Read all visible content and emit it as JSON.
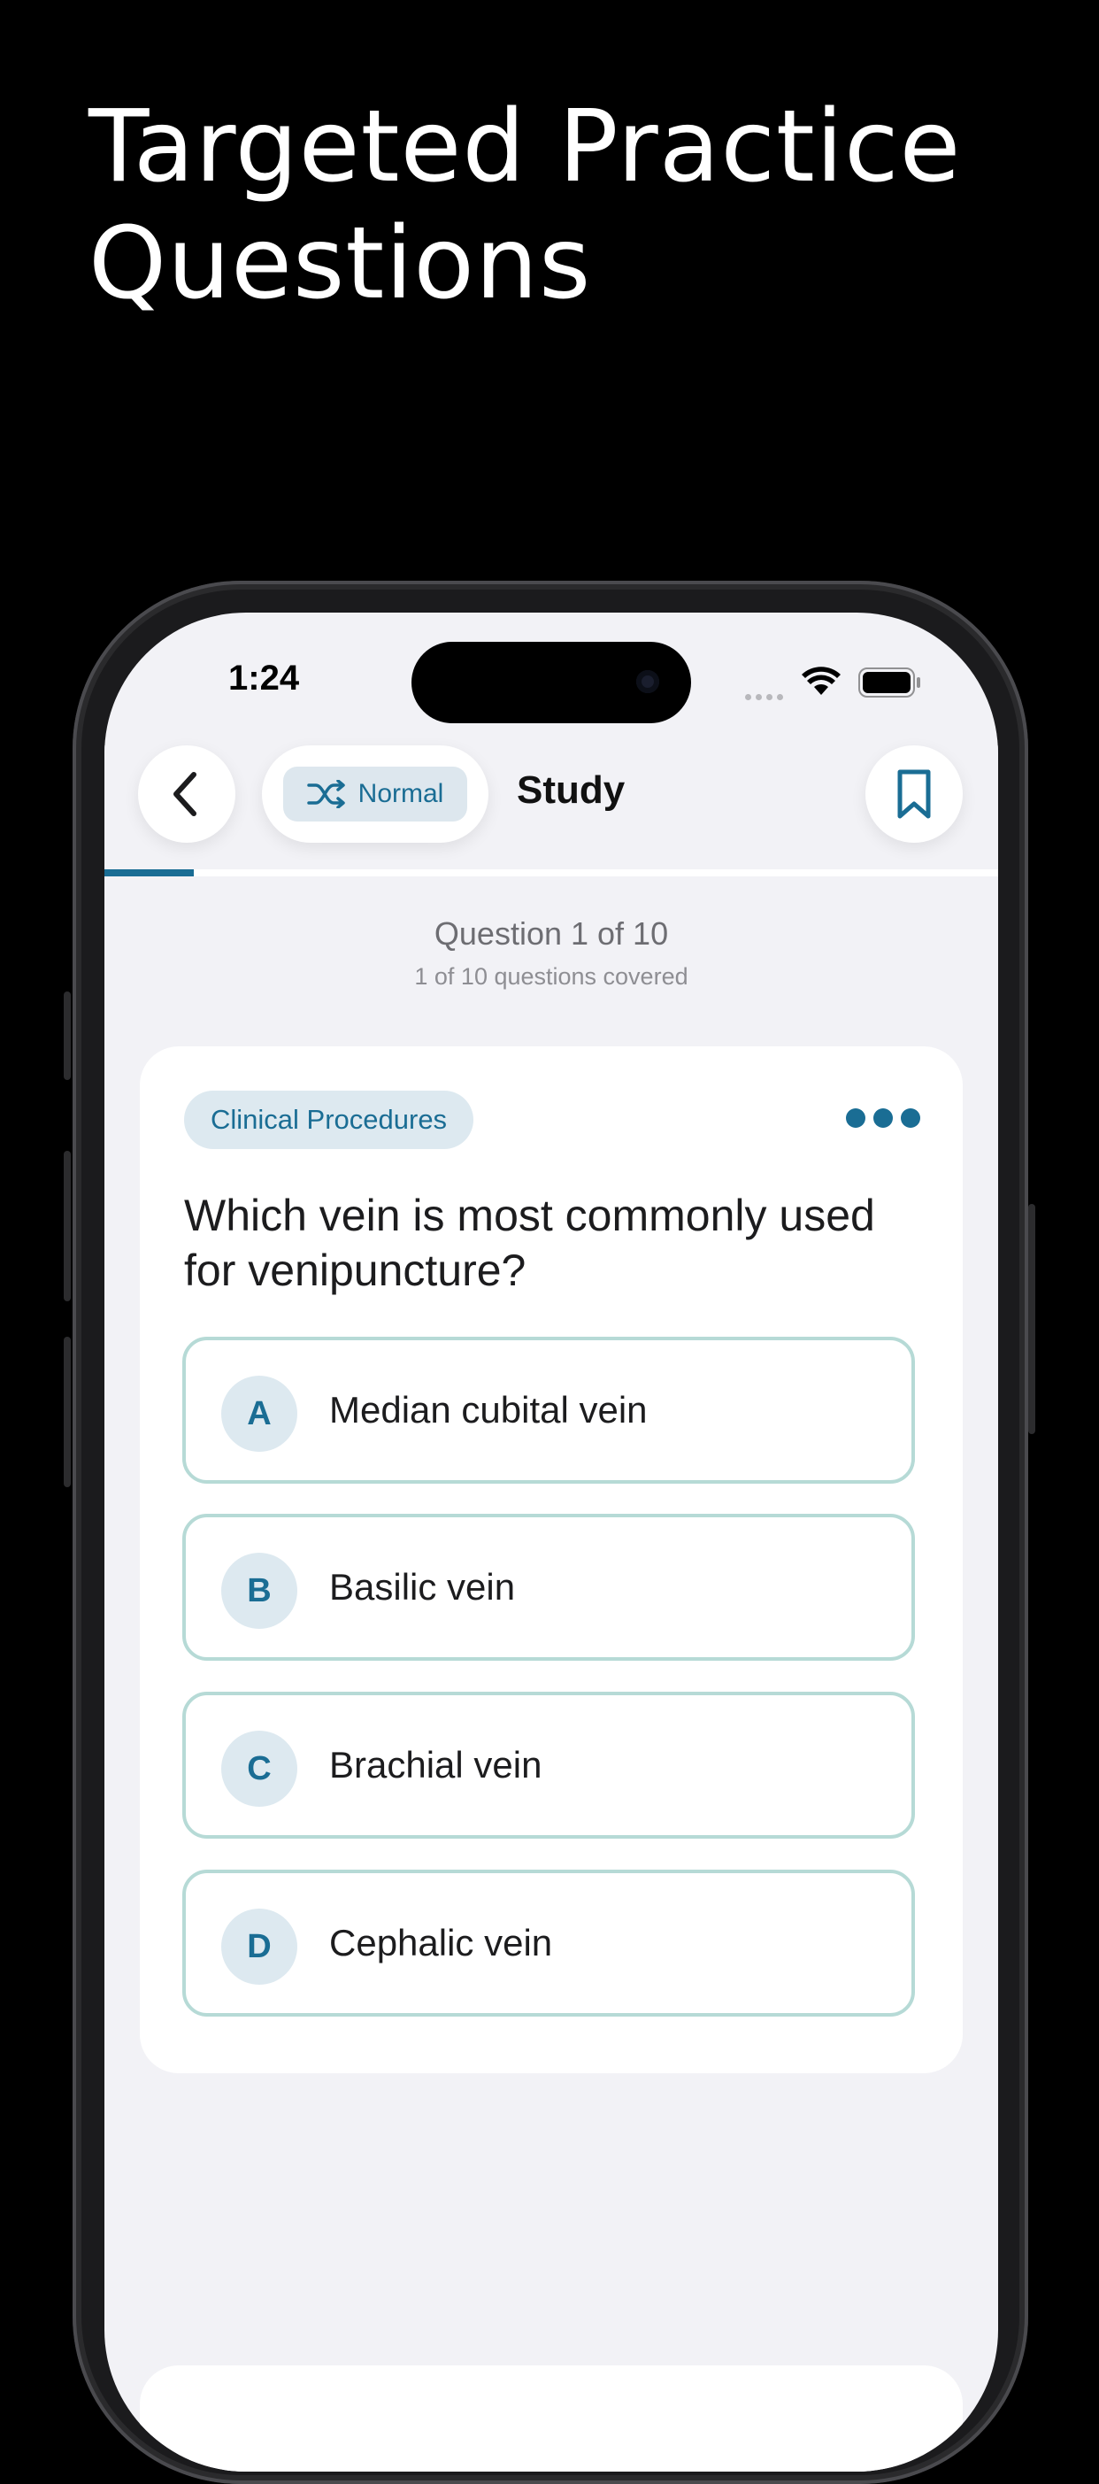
{
  "headline": {
    "line1": "Targeted Practice",
    "line2": "Questions"
  },
  "status_bar": {
    "time": "1:24"
  },
  "nav": {
    "mode_label": "Normal",
    "title": "Study"
  },
  "progress": {
    "fraction": 0.1
  },
  "question_info": {
    "counter": "Question 1 of 10",
    "covered": "1 of 10 questions covered"
  },
  "card": {
    "category": "Clinical Procedures",
    "question": "Which vein is most commonly used for venipuncture?",
    "options": [
      {
        "letter": "A",
        "text": "Median cubital vein"
      },
      {
        "letter": "B",
        "text": "Basilic vein"
      },
      {
        "letter": "C",
        "text": "Brachial vein"
      },
      {
        "letter": "D",
        "text": "Cephalic vein"
      }
    ]
  },
  "colors": {
    "accent": "#1a6d94",
    "option_border": "#b6dad6",
    "chip_bg": "#dde9f0",
    "screen_bg": "#f2f2f6"
  },
  "icons": {
    "back": "chevron-left-icon",
    "shuffle": "shuffle-icon",
    "bookmark": "bookmark-icon",
    "more": "ellipsis-icon"
  }
}
